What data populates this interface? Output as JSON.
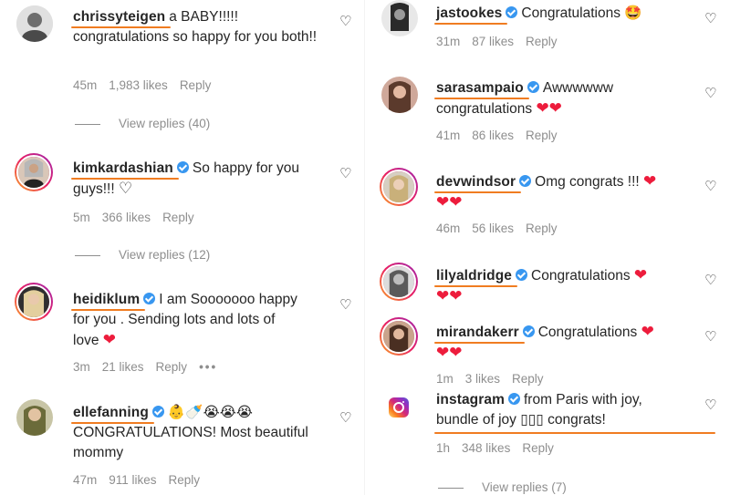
{
  "left": [
    {
      "username": "chrissyteigen",
      "verified": false,
      "text_line1": "a BABY!!!!!",
      "text_rest": "congratulations so happy for you both!!",
      "time": "45m",
      "likes": "1,983 likes",
      "reply": "Reply",
      "view_replies": "View replies (40)"
    },
    {
      "username": "kimkardashian",
      "verified": true,
      "text_line1": "So happy for you",
      "text_rest": "guys!!!",
      "emoji": "♡",
      "time": "5m",
      "likes": "366 likes",
      "reply": "Reply",
      "view_replies": "View replies (12)"
    },
    {
      "username": "heidiklum",
      "verified": true,
      "text_line1": "I am Sooooooo happy",
      "text_rest": "for you . Sending lots and lots of",
      "text_rest2": "love",
      "emoji": "❤",
      "time": "3m",
      "likes": "21 likes",
      "reply": "Reply",
      "more": "•••"
    },
    {
      "username": "ellefanning",
      "verified": true,
      "emoji": "👶🍼😭😭😭",
      "text_rest": "CONGRATULATIONS! Most beautiful",
      "text_rest2": "mommy",
      "time": "47m",
      "likes": "911 likes",
      "reply": "Reply"
    }
  ],
  "right": [
    {
      "username": "jastookes",
      "verified": true,
      "text_line1": "Congratulations",
      "emoji": "🤩",
      "time": "31m",
      "likes": "87 likes",
      "reply": "Reply"
    },
    {
      "username": "sarasampaio",
      "verified": true,
      "text_line1": "Awwwwww",
      "text_rest": "congratulations",
      "emoji": "❤❤",
      "time": "41m",
      "likes": "86 likes",
      "reply": "Reply"
    },
    {
      "username": "devwindsor",
      "verified": true,
      "text_line1": "Omg congrats !!!",
      "emoji": "❤",
      "emoji2": "❤❤",
      "time": "46m",
      "likes": "56 likes",
      "reply": "Reply"
    },
    {
      "username": "lilyaldridge",
      "verified": true,
      "text_line1": "Congratulations",
      "emoji": "❤",
      "emoji2": "❤❤"
    },
    {
      "username": "mirandakerr",
      "verified": true,
      "text_line1": "Congratulations",
      "emoji": "❤",
      "emoji2": "❤❤",
      "time": "1m",
      "likes": "3 likes",
      "reply": "Reply"
    },
    {
      "username": "instagram",
      "verified": true,
      "text_line1": "from Paris with joy,",
      "text_rest": "bundle of joy ▯▯▯ congrats!",
      "time": "1h",
      "likes": "348 likes",
      "reply": "Reply",
      "view_replies": "View replies (7)"
    }
  ],
  "like_icon": "heart-outline-icon",
  "colors": {
    "underline": "#f07c21",
    "verified": "#3897f0",
    "heart": "#ed1c3c",
    "meta": "#8e8e8e"
  }
}
